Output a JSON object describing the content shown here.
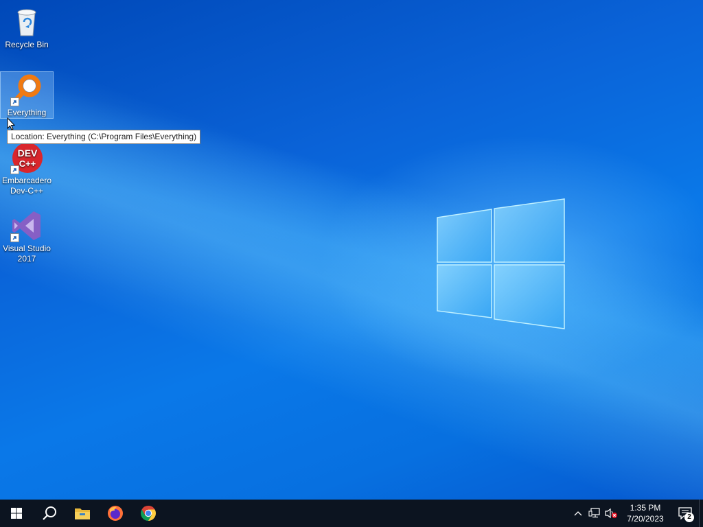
{
  "desktop": {
    "icons": [
      {
        "label": "Recycle Bin",
        "icon": "recycle-bin-icon"
      },
      {
        "label": "Everything",
        "icon": "everything-icon",
        "selected": true
      },
      {
        "label": "Embarcadero Dev-C++",
        "icon": "devcpp-icon"
      },
      {
        "label": "Visual Studio 2017",
        "icon": "visual-studio-icon"
      }
    ],
    "devcpp_logo_text_1": "DEV",
    "devcpp_logo_text_2": "C++",
    "tooltip": "Location: Everything (C:\\Program Files\\Everything)"
  },
  "taskbar": {
    "buttons": [
      {
        "name": "start",
        "icon": "windows-start-icon"
      },
      {
        "name": "search",
        "icon": "search-icon"
      },
      {
        "name": "file-explorer",
        "icon": "file-explorer-icon"
      },
      {
        "name": "firefox",
        "icon": "firefox-icon"
      },
      {
        "name": "chrome",
        "icon": "chrome-icon"
      }
    ],
    "tray": {
      "icons": [
        "chevron-up-icon",
        "network-icon",
        "volume-muted-icon"
      ],
      "time": "1:35 PM",
      "date": "7/20/2023",
      "notification_count": "2"
    }
  },
  "colors": {
    "taskbar": "#0c1420",
    "desktop_blue": "#0a63d8",
    "devcpp_red": "#d9262c",
    "everything_orange": "#f07a12",
    "vs_purple": "#865fc5"
  }
}
